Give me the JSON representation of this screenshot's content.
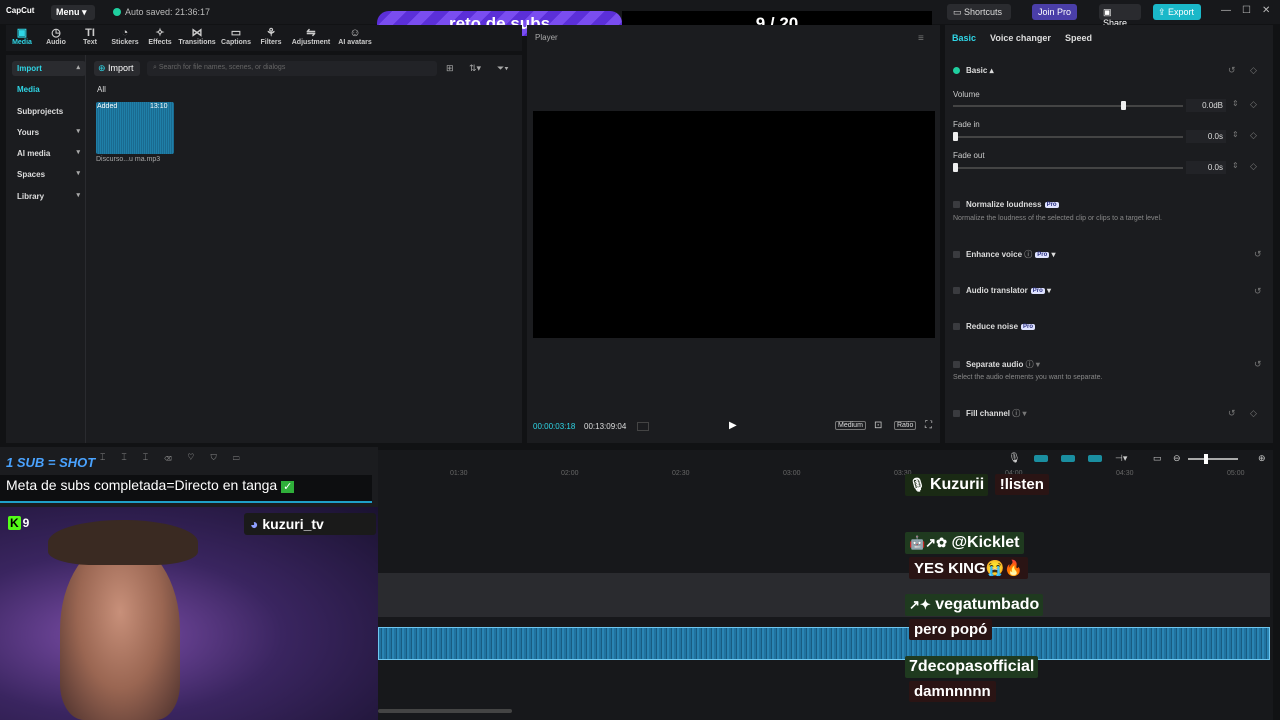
{
  "app": {
    "logo": "CapCut",
    "menu": "Menu",
    "autosave": "Auto saved: 21:36:17"
  },
  "topbar": {
    "shortcuts": "Shortcuts",
    "join_pro": "Join Pro",
    "share": "Share",
    "export": "Export"
  },
  "overlay": {
    "reto": "reto de subs",
    "counter": "9 / 20",
    "sub_shot": "1 SUB = SHOT",
    "meta": "Meta de subs completada=Directo en tanga",
    "discord": "kuzuri_tv",
    "kick_count": "9"
  },
  "tools": [
    {
      "label": "Media",
      "icon": "media-icon",
      "active": true
    },
    {
      "label": "Audio",
      "icon": "audio-icon"
    },
    {
      "label": "Text",
      "icon": "text-icon"
    },
    {
      "label": "Stickers",
      "icon": "stickers-icon"
    },
    {
      "label": "Effects",
      "icon": "effects-icon"
    },
    {
      "label": "Transitions",
      "icon": "transitions-icon"
    },
    {
      "label": "Captions",
      "icon": "captions-icon"
    },
    {
      "label": "Filters",
      "icon": "filters-icon"
    },
    {
      "label": "Adjustment",
      "icon": "adjustment-icon"
    },
    {
      "label": "AI avatars",
      "icon": "ai-avatars-icon"
    }
  ],
  "sidebar": {
    "items": [
      {
        "label": "Import",
        "selected": true
      },
      {
        "label": "Media"
      },
      {
        "label": "Subprojects"
      },
      {
        "label": "Yours"
      },
      {
        "label": "AI media"
      },
      {
        "label": "Spaces"
      },
      {
        "label": "Library"
      }
    ]
  },
  "media": {
    "import": "Import",
    "search_placeholder": "Search for file names, scenes, or dialogs",
    "filter_all": "All",
    "item": {
      "badge": "Added",
      "duration": "13:10",
      "name": "Discurso...u ma.mp3"
    }
  },
  "player": {
    "label": "Player",
    "time_current": "00:00:03:18",
    "time_total": "00:13:09:04",
    "quality": "Medium",
    "ratio": "Ratio"
  },
  "right": {
    "tabs": [
      "Basic",
      "Voice changer",
      "Speed"
    ],
    "basic": "Basic",
    "volume": {
      "label": "Volume",
      "value": "0.0dB",
      "level": 0.73
    },
    "fade_in": {
      "label": "Fade in",
      "value": "0.0s"
    },
    "fade_out": {
      "label": "Fade out",
      "value": "0.0s"
    },
    "normalize": {
      "label": "Normalize loudness",
      "desc": "Normalize the loudness of the selected clip or clips to a target level."
    },
    "enhance": "Enhance voice",
    "translator": "Audio translator",
    "reduce": "Reduce noise",
    "separate": {
      "label": "Separate audio",
      "desc": "Select the audio elements you want to separate."
    },
    "fill": "Fill channel",
    "pro": "Pro"
  },
  "timeline": {
    "ticks": [
      "01:30",
      "02:00",
      "02:30",
      "03:00",
      "03:30",
      "04:00",
      "04:30",
      "05:00"
    ]
  },
  "chat": [
    {
      "user": "Kuzurii",
      "msg": "!listen",
      "badge": "🎙"
    },
    {
      "user": "@Kicklet",
      "msg": "YES KING😭🔥",
      "badge": "🤖↗✿"
    },
    {
      "user": "vegatumbado",
      "msg": "pero popó",
      "badge": "↗✦"
    },
    {
      "user": "7decopasofficial",
      "msg": "damnnnnn",
      "badge": ""
    }
  ]
}
